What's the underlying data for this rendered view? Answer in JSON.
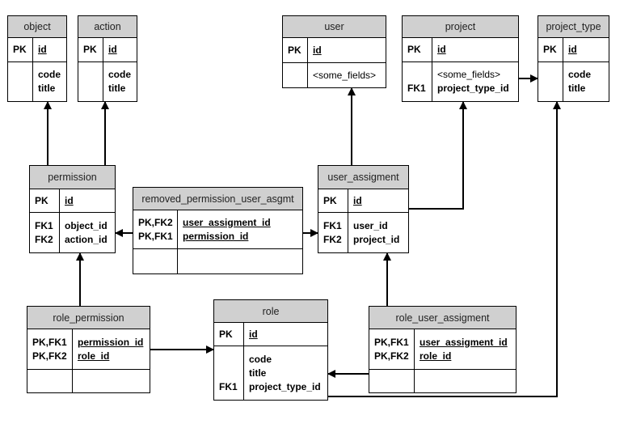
{
  "entities": [
    {
      "id": "object",
      "name": "object",
      "pk": [
        {
          "key": "PK",
          "field": "id"
        }
      ],
      "body": [
        {
          "key": "",
          "field": "code"
        },
        {
          "key": "",
          "field": "title"
        }
      ]
    },
    {
      "id": "action",
      "name": "action",
      "pk": [
        {
          "key": "PK",
          "field": "id"
        }
      ],
      "body": [
        {
          "key": "",
          "field": "code"
        },
        {
          "key": "",
          "field": "title"
        }
      ]
    },
    {
      "id": "user",
      "name": "user",
      "pk": [
        {
          "key": "PK",
          "field": "id"
        }
      ],
      "body": [
        {
          "key": "",
          "field": "<some_fields>"
        }
      ]
    },
    {
      "id": "project",
      "name": "project",
      "pk": [
        {
          "key": "PK",
          "field": "id"
        }
      ],
      "body": [
        {
          "key": "",
          "field": "<some_fields>"
        },
        {
          "key": "FK1",
          "field": "project_type_id"
        }
      ]
    },
    {
      "id": "project_type",
      "name": "project_type",
      "pk": [
        {
          "key": "PK",
          "field": "id"
        }
      ],
      "body": [
        {
          "key": "",
          "field": "code"
        },
        {
          "key": "",
          "field": "title"
        }
      ]
    },
    {
      "id": "permission",
      "name": "permission",
      "pk": [
        {
          "key": "PK",
          "field": "id"
        }
      ],
      "body": [
        {
          "key": "FK1",
          "field": "object_id"
        },
        {
          "key": "FK2",
          "field": "action_id"
        }
      ]
    },
    {
      "id": "removed_permission_user_asgmt",
      "name": "removed_permission_user_asgmt",
      "pk": [
        {
          "key": "PK,FK2",
          "field": "user_assigment_id"
        },
        {
          "key": "PK,FK1",
          "field": "permission_id"
        }
      ],
      "body": []
    },
    {
      "id": "user_assigment",
      "name": "user_assigment",
      "pk": [
        {
          "key": "PK",
          "field": "id"
        }
      ],
      "body": [
        {
          "key": "FK1",
          "field": "user_id"
        },
        {
          "key": "FK2",
          "field": "project_id"
        }
      ]
    },
    {
      "id": "role_permission",
      "name": "role_permission",
      "pk": [
        {
          "key": "PK,FK1",
          "field": "permission_id"
        },
        {
          "key": "PK,FK2",
          "field": "role_id"
        }
      ],
      "body": []
    },
    {
      "id": "role",
      "name": "role",
      "pk": [
        {
          "key": "PK",
          "field": "id"
        }
      ],
      "body": [
        {
          "key": "",
          "field": "code"
        },
        {
          "key": "",
          "field": "title"
        },
        {
          "key": "FK1",
          "field": "project_type_id"
        }
      ]
    },
    {
      "id": "role_user_assigment",
      "name": "role_user_assigment",
      "pk": [
        {
          "key": "PK,FK1",
          "field": "user_assigment_id"
        },
        {
          "key": "PK,FK2",
          "field": "role_id"
        }
      ],
      "body": []
    }
  ],
  "relationships": [
    {
      "from": "permission",
      "to": "object"
    },
    {
      "from": "permission",
      "to": "action"
    },
    {
      "from": "removed_permission_user_asgmt",
      "to": "permission"
    },
    {
      "from": "removed_permission_user_asgmt",
      "to": "user_assigment"
    },
    {
      "from": "user_assigment",
      "to": "user"
    },
    {
      "from": "user_assigment",
      "to": "project"
    },
    {
      "from": "project",
      "to": "project_type"
    },
    {
      "from": "role",
      "to": "project_type"
    },
    {
      "from": "role_permission",
      "to": "permission"
    },
    {
      "from": "role_permission",
      "to": "role"
    },
    {
      "from": "role_user_assigment",
      "to": "role"
    },
    {
      "from": "role_user_assigment",
      "to": "user_assigment"
    }
  ],
  "colors": {
    "header": "#d0d0d0",
    "line": "#000000"
  }
}
